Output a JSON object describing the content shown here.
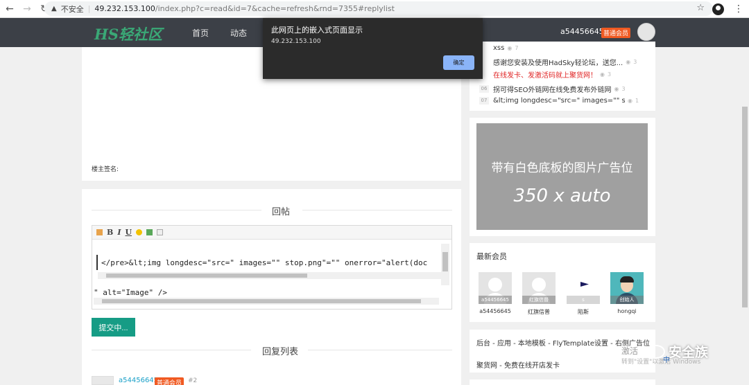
{
  "browser": {
    "insecure_label": "不安全",
    "url_host": "49.232.153.100",
    "url_path": "/index.php?c=read&id=7&cache=refresh&rnd=7355#replylist"
  },
  "header": {
    "logo": "HS轻社区",
    "nav": [
      "首页",
      "动态"
    ],
    "username": "a54456645",
    "user_badge": "普通会员"
  },
  "alert": {
    "title": "此网页上的嵌入式页面显示",
    "message": "49.232.153.100",
    "ok_label": "确定"
  },
  "post": {
    "signature_label": "楼主签名:"
  },
  "reply": {
    "title": "回帖",
    "code_line1": "</pre>&lt;img  longdesc=\"src=\" images=\"\" stop.png\"=\"\" onerror=\"alert(doc",
    "code_line2": "\" alt=\"Image\" />",
    "submit_label": "提交中...",
    "list_title": "回复列表",
    "first_reply": {
      "user": "a54456645",
      "badge": "普通会员",
      "floor": "#2"
    }
  },
  "hot_list": [
    {
      "num": "",
      "title": "xss",
      "views": "7",
      "red": false
    },
    {
      "num": "",
      "title": "感谢您安装及使用HadSky轻论坛，送您...",
      "views": "3",
      "red": false
    },
    {
      "num": "",
      "title": "在线发卡、发激活码就上聚货网！",
      "views": "3",
      "red": true
    },
    {
      "num": "06",
      "title": "拐可得SEO外链网在线免费发布外链网",
      "views": "3",
      "red": false
    },
    {
      "num": "07",
      "title": "&lt;img longdesc=\"src=\" images=\"\" stop....",
      "views": "1",
      "red": false
    }
  ],
  "ad": {
    "line1": "带有白色底板的图片广告位",
    "line2": "350 x auto"
  },
  "members": {
    "title": "最新会员",
    "items": [
      {
        "name": "a54456645",
        "caption": "a54456645"
      },
      {
        "name": "红旗信普",
        "caption": "红旗信普"
      },
      {
        "name": "陷斯",
        "caption": "s"
      },
      {
        "name": "hongqi",
        "caption": "创始人"
      }
    ]
  },
  "links": {
    "line1": "后台 - 应用 - 本地模板 - FlyTemplate设置 - 右侧广告位",
    "line2": "聚货网 - 免费在线开店发卡"
  },
  "watermark": {
    "text": "安全族",
    "win1": "激活",
    "win2": "转到\"设置\"以激活 Windows",
    "ime": "中"
  },
  "colors": {
    "header_bg": "#3c4047",
    "logo": "#3aa876",
    "badge": "#f05a22",
    "submit": "#169c85",
    "link": "#1aa0c8"
  }
}
